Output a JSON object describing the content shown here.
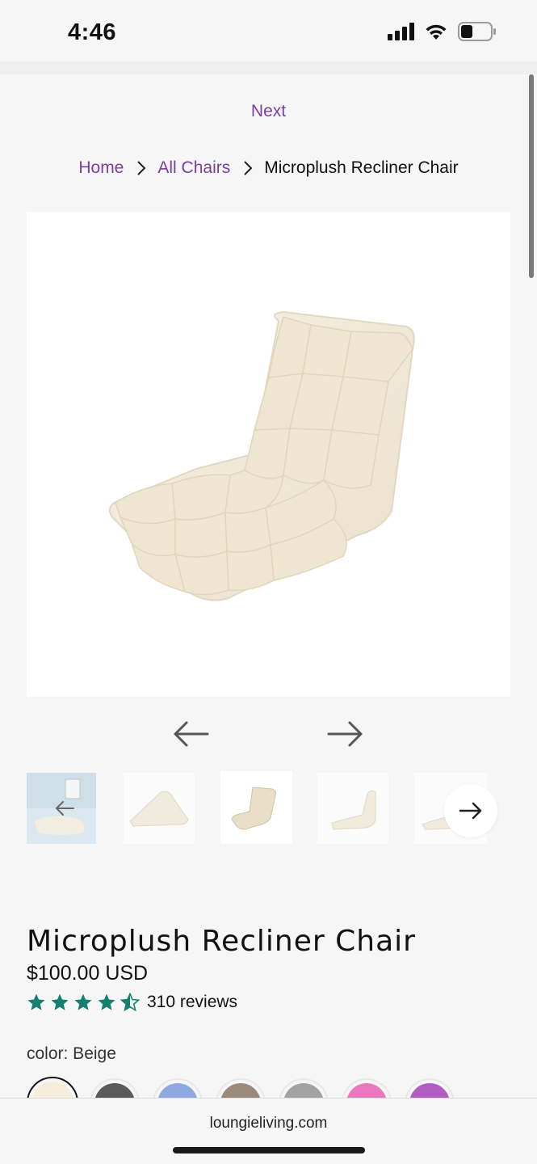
{
  "status": {
    "time": "4:46"
  },
  "nav": {
    "next_label": "Next"
  },
  "breadcrumb": {
    "home": "Home",
    "category": "All Chairs",
    "current": "Microplush Recliner Chair"
  },
  "product": {
    "title": "Microplush Recliner Chair",
    "price": "$100.00 USD",
    "rating": 4.5,
    "reviews_label": "310 reviews",
    "color_label": "color: Beige",
    "swatches": [
      {
        "name": "Beige",
        "color": "#f6eedb",
        "selected": true
      },
      {
        "name": "Charcoal",
        "color": "#5a5a5a"
      },
      {
        "name": "Blue",
        "color": "#8ea8e0"
      },
      {
        "name": "Taupe",
        "color": "#998a7c"
      },
      {
        "name": "Gray",
        "color": "#a3a3a3"
      },
      {
        "name": "Pink",
        "color": "#ea78c0"
      },
      {
        "name": "Purple",
        "color": "#b05cc0"
      }
    ]
  },
  "gallery": {
    "icons": [
      "arrow-left-icon",
      "arrow-right-icon"
    ],
    "thumbnail_count": 5,
    "active_index": 2
  },
  "browser": {
    "url": "loungieliving.com"
  },
  "colors": {
    "link": "#7d3d9e",
    "star": "#16806f",
    "background": "#f6f6f6"
  }
}
